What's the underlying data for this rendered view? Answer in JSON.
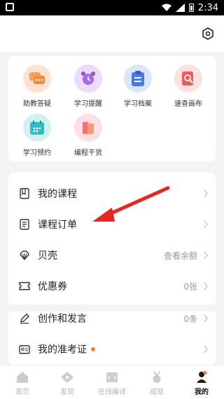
{
  "status_bar": {
    "time": "2:34"
  },
  "tools": [
    {
      "label": "助教答疑",
      "icon": "chat-bubbles-icon"
    },
    {
      "label": "学习提醒",
      "icon": "alarm-clock-icon"
    },
    {
      "label": "学习档案",
      "icon": "clipboard-icon"
    },
    {
      "label": "速查画布",
      "icon": "magnifier-doc-icon"
    },
    {
      "label": "学习预约",
      "icon": "calendar-icon"
    },
    {
      "label": "编程干货",
      "icon": "books-icon"
    }
  ],
  "menu": {
    "my_courses": "我的课程",
    "course_orders": "课程订单",
    "shells": "贝壳",
    "shells_value": "查看余额",
    "coupons": "优惠券",
    "coupons_value": "0张",
    "creations": "创作和发言",
    "creations_value": "0条",
    "admission_ticket": "我的准考证"
  },
  "tabbar": [
    {
      "label": "首页",
      "icon": "home-icon"
    },
    {
      "label": "发现",
      "icon": "compass-icon"
    },
    {
      "label": "在线编译",
      "icon": "code-editor-icon"
    },
    {
      "label": "成就",
      "icon": "medal-icon"
    },
    {
      "label": "我的",
      "icon": "user-icon"
    }
  ],
  "colors": {
    "accent_orange": "#ff7a30",
    "arrow_red": "#e8251f",
    "background": "#f3f4f6"
  }
}
